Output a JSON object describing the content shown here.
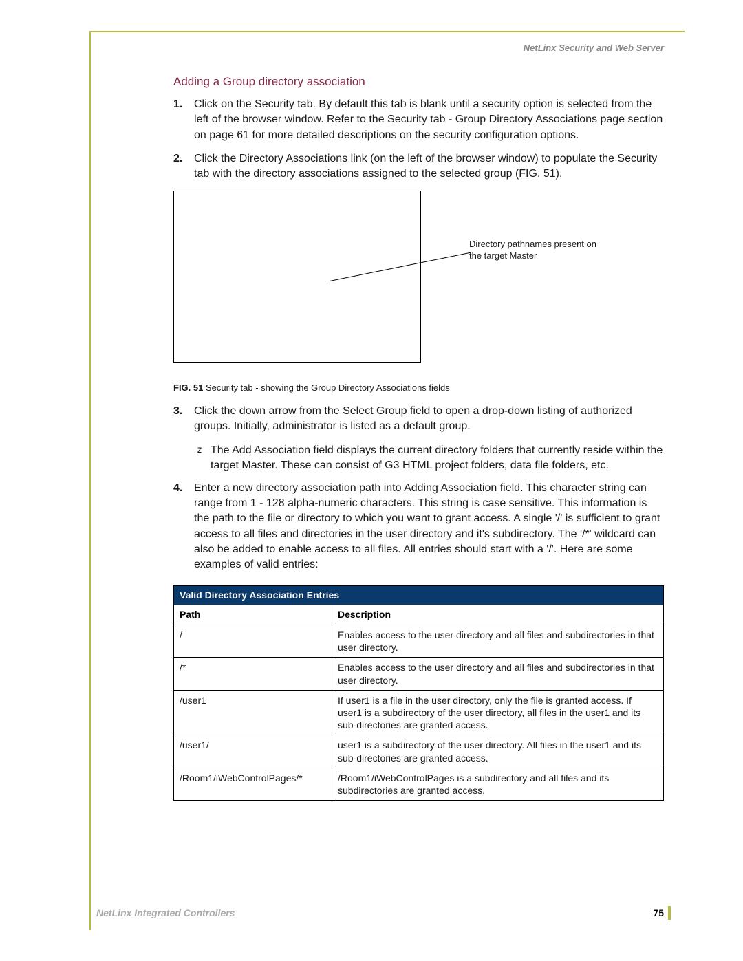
{
  "header": {
    "running_head": "NetLinx Security and Web Server"
  },
  "section_heading": "Adding a Group directory association",
  "steps": {
    "s1": "Click on the Security tab. By default this tab is blank until a security option is selected from the left of the browser window. Refer to the Security tab - Group Directory Associations page section on page 61 for more detailed descriptions on the security configuration options.",
    "s2": "Click the Directory Associations link (on the left of the browser window) to populate the Security tab with the directory associations assigned to the selected group (FIG. 51).",
    "s3": "Click the down arrow from the Select Group field to open a drop-down listing of authorized groups. Initially, administrator is listed as a default group.",
    "s4": "Enter a new directory association path into Adding Association field. This character string can range from 1 - 128 alpha-numeric characters. This string is case sensitive. This information is the path to the file or directory to which you want to grant access. A single '/' is sufficient to grant access to all files and directories in the user directory and it's subdirectory. The '/*' wildcard can also be added to enable access to all files. All entries should start with a '/'. Here are some examples of valid entries:"
  },
  "callout": {
    "text": "Directory pathnames present on the target Master"
  },
  "fig_caption": {
    "label": "FIG. 51",
    "text": "Security tab - showing the Group Directory Associations fields"
  },
  "bullet1": "The Add Association field displays the current directory folders that currently reside within the target Master. These can consist of G3 HTML project folders, data file folders, etc.",
  "table": {
    "title": "Valid Directory Association Entries",
    "head_path": "Path",
    "head_desc": "Description",
    "rows": [
      {
        "path": "/",
        "desc": "Enables access to the user directory and all files and subdirectories in that user directory."
      },
      {
        "path": "/*",
        "desc": "Enables access to the user directory and all files and subdirectories in that user directory."
      },
      {
        "path": "/user1",
        "desc": "If user1   is a file in the user directory, only the file is granted access. If user1   is a subdirectory of the user directory, all files in the user1   and its sub-directories are granted access."
      },
      {
        "path": "/user1/",
        "desc": "user1      is a subdirectory of the user directory. All files in the user1   and its sub-directories are granted access."
      },
      {
        "path": "/Room1/iWebControlPages/*",
        "desc": "/Room1/iWebControlPages              is a subdirectory and all files and its subdirectories are granted access."
      }
    ]
  },
  "footer": {
    "title": "NetLinx Integrated Controllers",
    "page": "75"
  }
}
